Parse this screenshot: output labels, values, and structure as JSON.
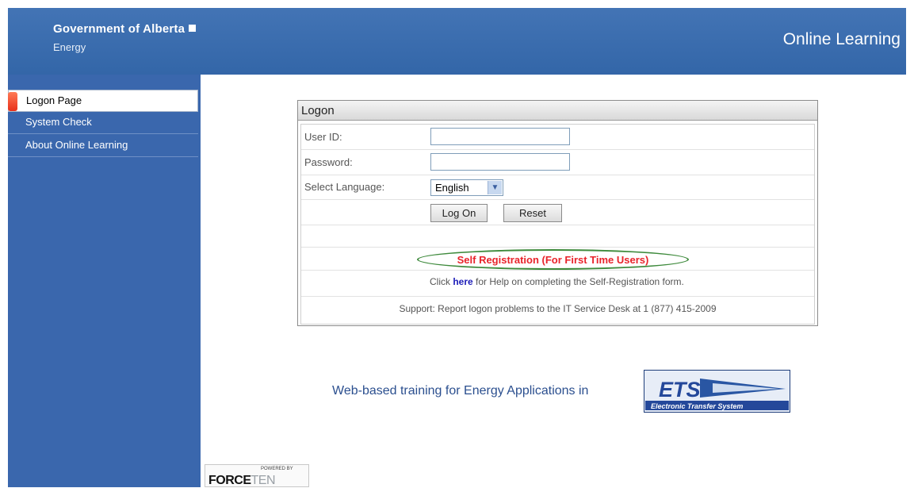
{
  "header": {
    "org_name": "Government of Alberta",
    "department": "Energy",
    "app_title": "Online Learning"
  },
  "sidebar": {
    "items": [
      {
        "label": "Logon Page",
        "active": true
      },
      {
        "label": "System Check",
        "active": false
      },
      {
        "label": "About Online Learning",
        "active": false
      }
    ]
  },
  "logon": {
    "title": "Logon",
    "user_id_label": "User ID:",
    "user_id_value": "",
    "password_label": "Password:",
    "password_value": "",
    "language_label": "Select Language:",
    "language_selected": "English",
    "logon_button": "Log On",
    "reset_button": "Reset",
    "self_registration": "Self Registration (For First Time Users)",
    "help_prefix": "Click",
    "help_link": "here",
    "help_suffix": "for Help on completing the Self-Registration form.",
    "support": "Support: Report logon problems to the IT Service Desk at 1 (877) 415-2009"
  },
  "footer": {
    "training_text": "Web-based training for Energy Applications in",
    "ets_logo": "ETS",
    "ets_subtitle": "Electronic Transfer System",
    "powered_by": "POWERED BY",
    "force_brand": "FORCE",
    "ten_brand": "TEN"
  },
  "colors": {
    "header_blue": "#3a6bb0",
    "sidebar_blue": "#3a67ad",
    "self_registration_red": "#e8232a",
    "highlight_green": "#3e8a3c",
    "link_blue": "#1d1db8"
  }
}
